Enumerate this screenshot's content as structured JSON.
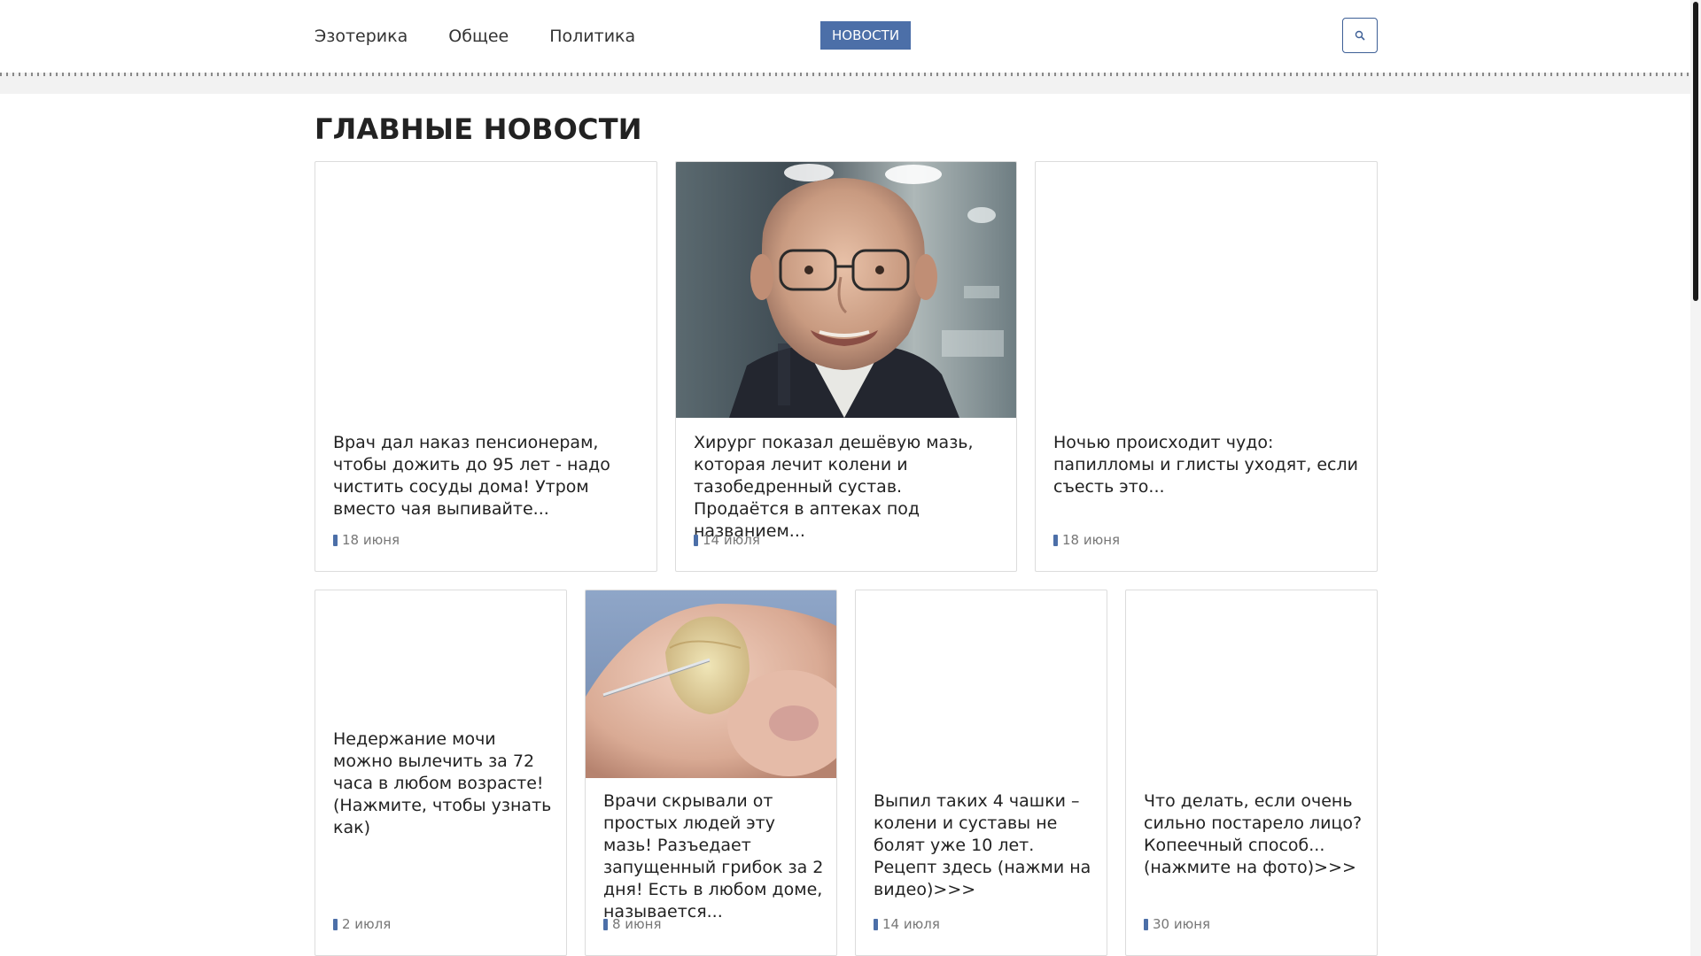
{
  "nav": {
    "items": [
      {
        "label": "Эзотерика"
      },
      {
        "label": "Общее"
      },
      {
        "label": "Политика"
      }
    ],
    "badge": "НОВОСТИ",
    "search_icon": "search-icon"
  },
  "section": {
    "title": "ГЛАВНЫЕ НОВОСТИ"
  },
  "cards": [
    {
      "title": "Врач дал наказ пенсионерам, чтобы дожить до 95 лет - надо чистить сосуды дома! Утром вместо чая выпивайте...",
      "date": "18 июня"
    },
    {
      "title": "Хирург показал дешёвую мазь, которая лечит колени и тазобедренный сустав. Продаётся в аптеках под названием...",
      "date": "14 июля"
    },
    {
      "title": "Ночью происходит чудо: папилломы и глисты уходят, если съесть это...",
      "date": "18 июня"
    },
    {
      "title": "Недержание мочи можно вылечить за 72 часа в любом возрасте! (Нажмите, чтобы узнать как)",
      "date": "2 июля"
    },
    {
      "title": "Врачи скрывали от простых людей эту мазь! Разъедает запущенный грибок за 2 дня! Есть в любом доме, называется...",
      "date": "8 июня"
    },
    {
      "title": "Выпил таких 4 чашки – колени и суставы не болят уже 10 лет. Рецепт здесь (нажми на видео)>>>",
      "date": "14 июля"
    },
    {
      "title": "Что делать, если очень сильно постарело лицо? Копеечный способ... (нажмите на фото)>>>",
      "date": "30 июня"
    }
  ],
  "colors": {
    "accent": "#4c6fa8",
    "text": "#222222",
    "muted": "#777777",
    "border": "#dcdcdc"
  }
}
